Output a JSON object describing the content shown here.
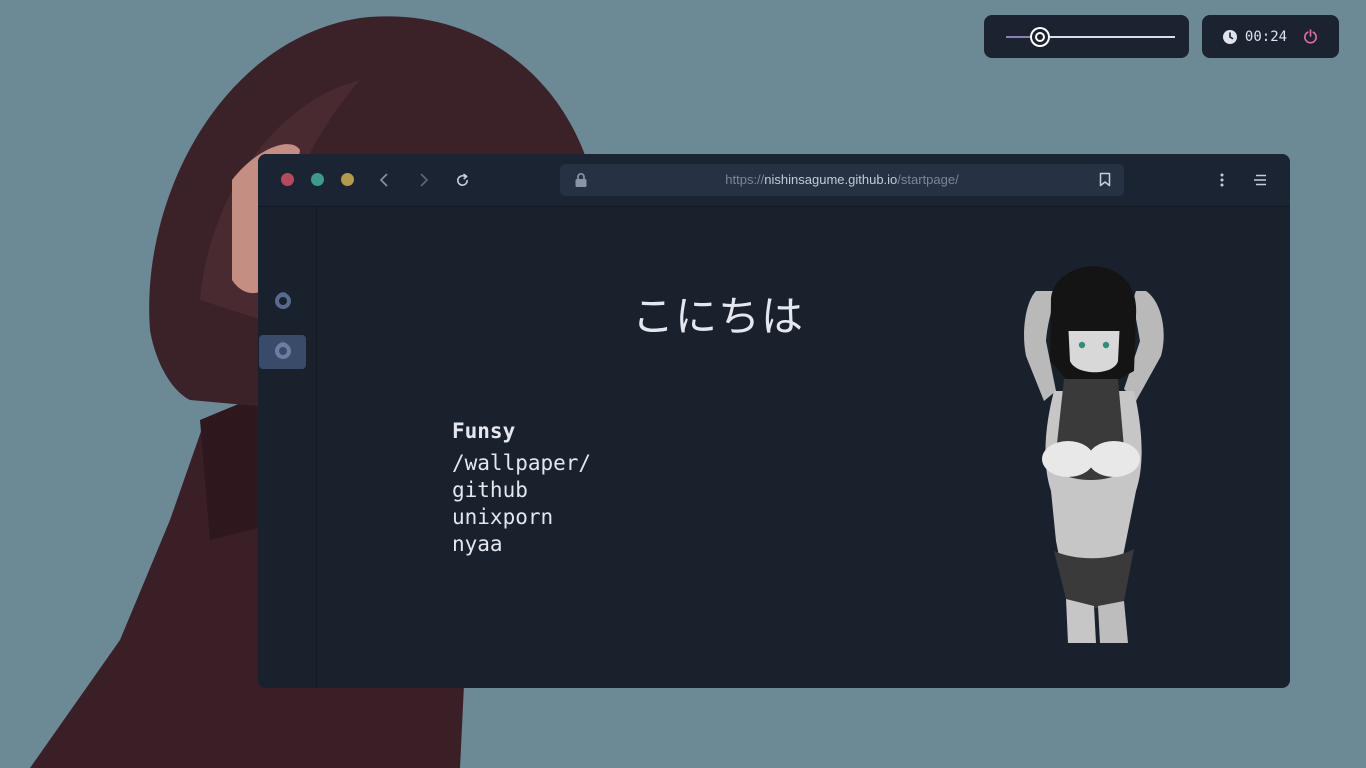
{
  "widgets": {
    "volume": {
      "level": 0.2
    },
    "clock": {
      "time": "00:24"
    }
  },
  "browser": {
    "url": {
      "scheme": "https://",
      "host": "nishinsagume.github.io",
      "path": "/startpage/"
    },
    "window_controls": [
      "close",
      "minimize",
      "maximize"
    ],
    "sidebar": {
      "items": [
        "firefox-icon",
        "firefox-icon"
      ],
      "active_index": 1
    }
  },
  "startpage": {
    "greeting": "こにちは",
    "links_title": "Funsy",
    "links": [
      "/wallpaper/",
      "github",
      "unixporn",
      "nyaa"
    ]
  },
  "colors": {
    "desktop_bg": "#6b8a96",
    "window_bg": "#19212d",
    "close_dot": "#b54a5c",
    "minimize_dot": "#3e9a8a",
    "maximize_dot": "#b59a4c",
    "power": "#e06c9f"
  }
}
